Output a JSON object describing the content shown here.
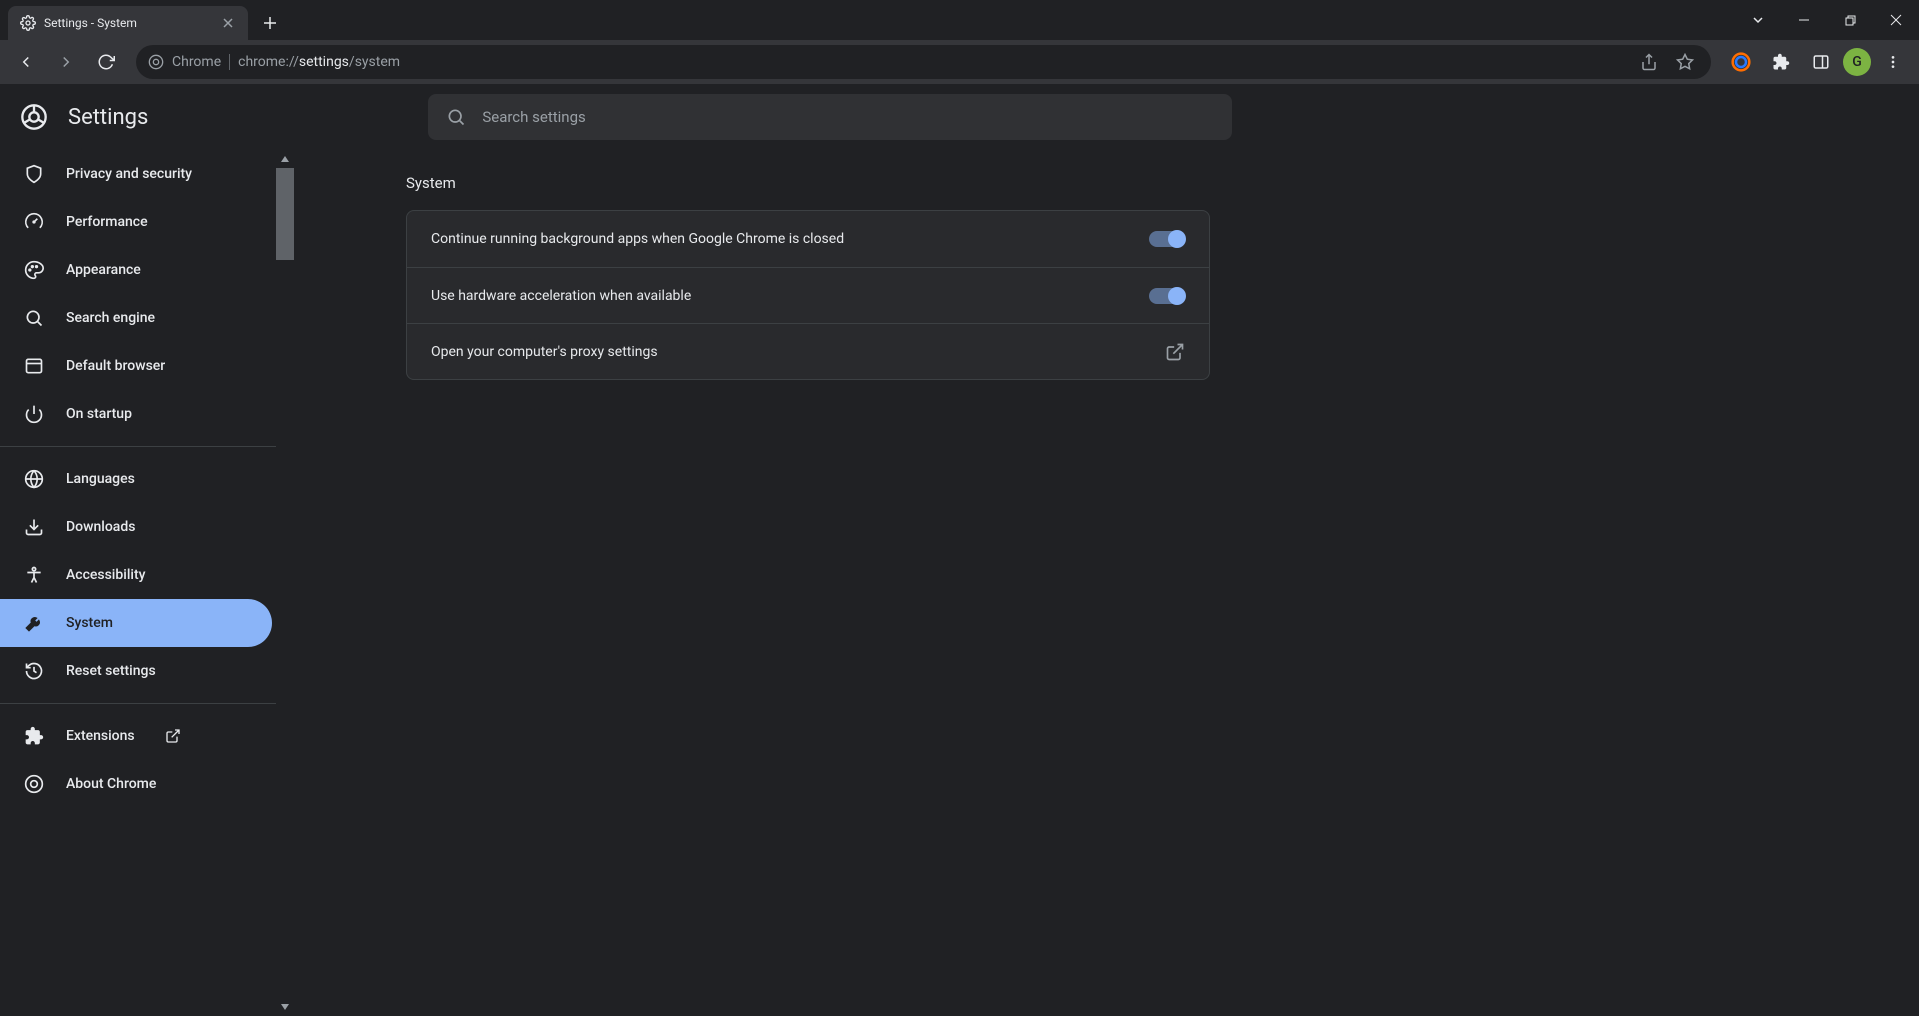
{
  "window": {
    "tab_title": "Settings - System"
  },
  "toolbar": {
    "chrome_label": "Chrome",
    "url_prefix": "chrome://",
    "url_bold": "settings",
    "url_suffix": "/system",
    "avatar_letter": "G"
  },
  "header": {
    "title": "Settings",
    "search_placeholder": "Search settings"
  },
  "sidebar": {
    "items": [
      {
        "id": "privacy",
        "label": "Privacy and security",
        "icon": "shield"
      },
      {
        "id": "performance",
        "label": "Performance",
        "icon": "speed"
      },
      {
        "id": "appearance",
        "label": "Appearance",
        "icon": "palette"
      },
      {
        "id": "search",
        "label": "Search engine",
        "icon": "search"
      },
      {
        "id": "default",
        "label": "Default browser",
        "icon": "browser"
      },
      {
        "id": "startup",
        "label": "On startup",
        "icon": "power"
      }
    ],
    "items2": [
      {
        "id": "languages",
        "label": "Languages",
        "icon": "globe"
      },
      {
        "id": "downloads",
        "label": "Downloads",
        "icon": "download"
      },
      {
        "id": "accessibility",
        "label": "Accessibility",
        "icon": "accessibility"
      },
      {
        "id": "system",
        "label": "System",
        "icon": "wrench",
        "active": true
      },
      {
        "id": "reset",
        "label": "Reset settings",
        "icon": "history"
      }
    ],
    "items3": [
      {
        "id": "extensions",
        "label": "Extensions",
        "icon": "puzzle",
        "external": true
      },
      {
        "id": "about",
        "label": "About Chrome",
        "icon": "chrome"
      }
    ]
  },
  "main": {
    "section_title": "System",
    "rows": [
      {
        "label": "Continue running background apps when Google Chrome is closed",
        "type": "toggle",
        "on": true
      },
      {
        "label": "Use hardware acceleration when available",
        "type": "toggle",
        "on": true
      },
      {
        "label": "Open your computer's proxy settings",
        "type": "link"
      }
    ]
  },
  "colors": {
    "accent": "#8ab4f8"
  }
}
